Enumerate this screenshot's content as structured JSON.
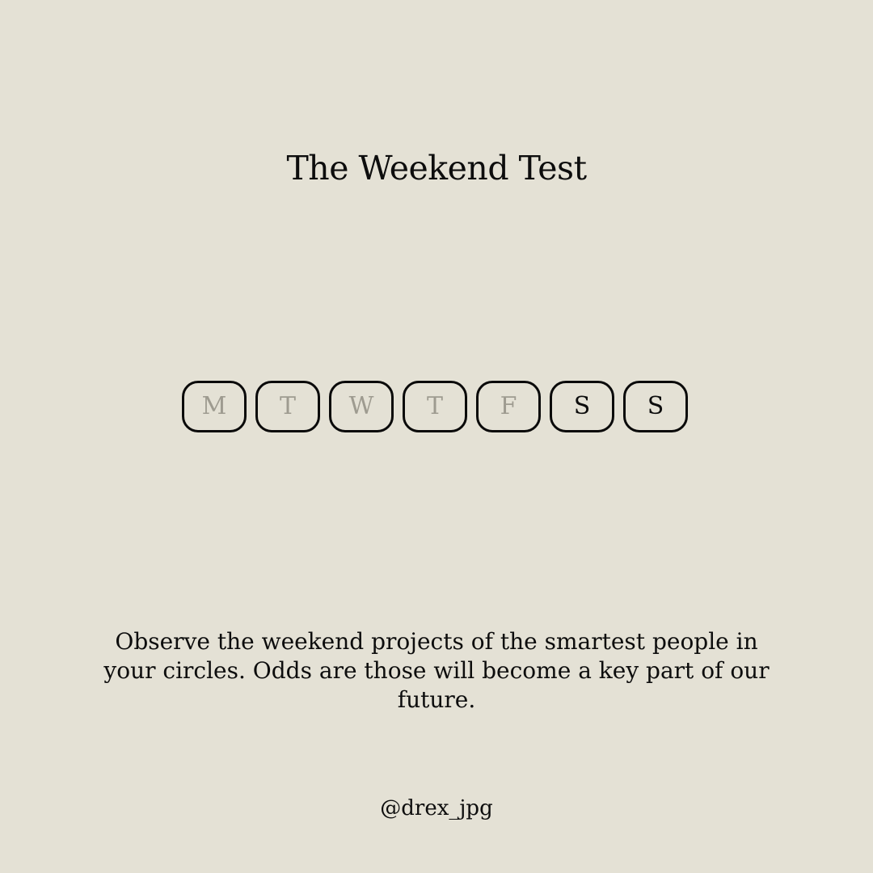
{
  "title": "The Weekend Test",
  "days": [
    {
      "letter": "M",
      "active": false
    },
    {
      "letter": "T",
      "active": false
    },
    {
      "letter": "W",
      "active": false
    },
    {
      "letter": "T",
      "active": false
    },
    {
      "letter": "F",
      "active": false
    },
    {
      "letter": "S",
      "active": true
    },
    {
      "letter": "S",
      "active": true
    }
  ],
  "quote": "Observe the weekend projects of the smartest people in your circles. Odds are those will become a key part of our future.",
  "handle": "@drex_jpg",
  "colors": {
    "background": "#e4e1d5",
    "text": "#0d0d0d",
    "inactive_day": "#9e9b90",
    "border": "#0a0a0a"
  }
}
